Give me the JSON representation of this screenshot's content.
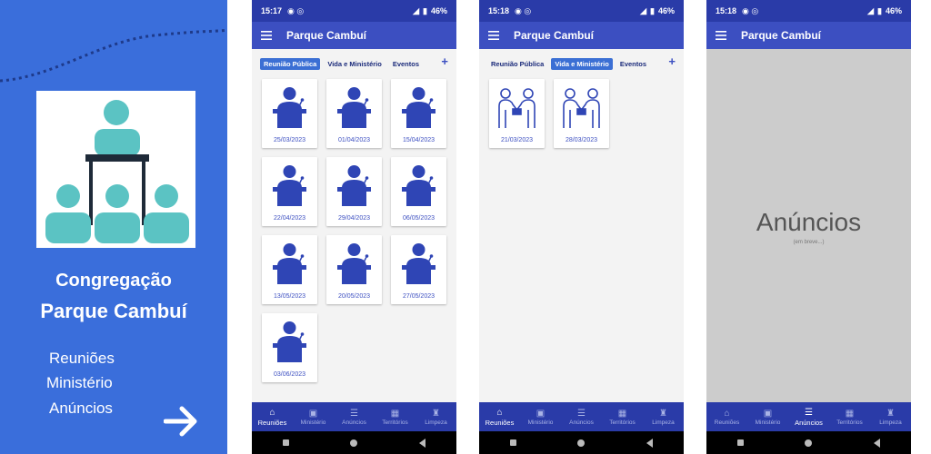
{
  "promo": {
    "line1": "Congregação",
    "line2": "Parque Cambuí",
    "features": [
      "Reuniões",
      "Ministério",
      "Anúncios"
    ],
    "colors": {
      "background": "#3a6edb",
      "logo_teal": "#5bc3c3",
      "logo_dark": "#1e2a38"
    }
  },
  "phones": [
    {
      "status": {
        "time": "15:17",
        "battery": "46%"
      },
      "app_title": "Parque Cambuí",
      "tabs": [
        {
          "label": "Reunião Pública",
          "active": true
        },
        {
          "label": "Vida e Ministério",
          "active": false
        },
        {
          "label": "Eventos",
          "active": false
        }
      ],
      "cards": [
        {
          "date": "25/03/2023",
          "icon": "speaker-podium-icon"
        },
        {
          "date": "01/04/2023",
          "icon": "speaker-podium-icon"
        },
        {
          "date": "15/04/2023",
          "icon": "speaker-podium-icon"
        },
        {
          "date": "22/04/2023",
          "icon": "speaker-podium-icon"
        },
        {
          "date": "29/04/2023",
          "icon": "speaker-podium-icon"
        },
        {
          "date": "06/05/2023",
          "icon": "speaker-podium-icon"
        },
        {
          "date": "13/05/2023",
          "icon": "speaker-podium-icon"
        },
        {
          "date": "20/05/2023",
          "icon": "speaker-podium-icon"
        },
        {
          "date": "27/05/2023",
          "icon": "speaker-podium-icon"
        },
        {
          "date": "03/06/2023",
          "icon": "speaker-podium-icon"
        }
      ],
      "active_nav": 0
    },
    {
      "status": {
        "time": "15:18",
        "battery": "46%"
      },
      "app_title": "Parque Cambuí",
      "tabs": [
        {
          "label": "Reunião Pública",
          "active": false
        },
        {
          "label": "Vida e Ministério",
          "active": true
        },
        {
          "label": "Eventos",
          "active": false
        }
      ],
      "cards": [
        {
          "date": "21/03/2023",
          "icon": "handshake-icon"
        },
        {
          "date": "28/03/2023",
          "icon": "handshake-icon"
        }
      ],
      "active_nav": 0
    },
    {
      "status": {
        "time": "15:18",
        "battery": "46%"
      },
      "app_title": "Parque Cambuí",
      "placeholder": {
        "title": "Anúncios",
        "subtitle": "(em breve...)"
      },
      "active_nav": 2
    }
  ],
  "bottom_nav": [
    {
      "label": "Reuniões",
      "icon": "home-icon"
    },
    {
      "label": "Ministério",
      "icon": "briefcase-icon"
    },
    {
      "label": "Anúncios",
      "icon": "list-icon"
    },
    {
      "label": "Territórios",
      "icon": "map-icon"
    },
    {
      "label": "Limpeza",
      "icon": "broom-icon"
    }
  ],
  "theme": {
    "primary": "#3c4fc1",
    "primary_dark": "#2a3ba8",
    "accent": "#3b6fd4"
  }
}
